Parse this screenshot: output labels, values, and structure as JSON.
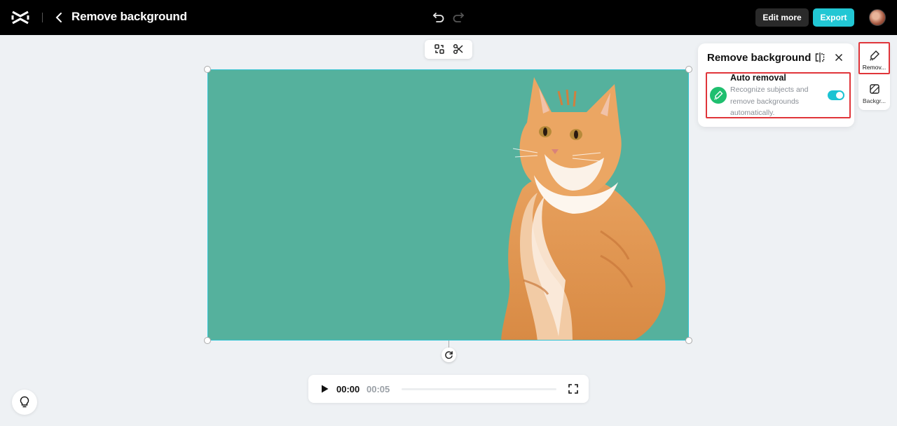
{
  "header": {
    "title": "Remove background",
    "edit_more_label": "Edit more",
    "export_label": "Export"
  },
  "player": {
    "current_time": "00:00",
    "duration": "00:05",
    "progress": 0
  },
  "panel": {
    "title": "Remove background",
    "auto_removal": {
      "title": "Auto removal",
      "description": "Recognize subjects and remove backgrounds automatically.",
      "enabled": true
    }
  },
  "rail": {
    "items": [
      {
        "label": "Remov...",
        "icon": "eraser-icon",
        "active": true
      },
      {
        "label": "Backgr...",
        "icon": "background-icon",
        "active": false
      }
    ]
  },
  "colors": {
    "accent": "#22c7d4",
    "canvas_bg": "#55b19d",
    "highlight": "#e0353a",
    "auto_icon_bg": "#1fbf6f"
  }
}
